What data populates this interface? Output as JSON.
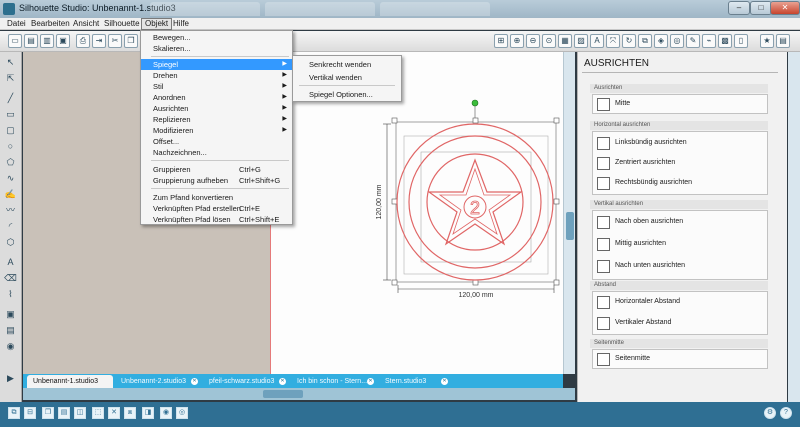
{
  "window": {
    "title": "Silhouette Studio: Unbenannt-1.studio3",
    "controls": {
      "minimize": "–",
      "maximize": "□",
      "close": "✕"
    }
  },
  "menubar": [
    "Datei",
    "Bearbeiten",
    "Ansicht",
    "Silhouette",
    "Objekt",
    "Hilfe"
  ],
  "object_menu": {
    "items": [
      {
        "label": "Bewegen...",
        "shortcut": "",
        "submenu": false
      },
      {
        "label": "Skalieren...",
        "shortcut": "",
        "submenu": false
      },
      {
        "label": "Spiegel",
        "shortcut": "",
        "submenu": true,
        "highlighted": true
      },
      {
        "label": "Drehen",
        "shortcut": "",
        "submenu": true
      },
      {
        "label": "Stil",
        "shortcut": "",
        "submenu": true
      },
      {
        "label": "Anordnen",
        "shortcut": "",
        "submenu": true
      },
      {
        "label": "Ausrichten",
        "shortcut": "",
        "submenu": true
      },
      {
        "label": "Replizieren",
        "shortcut": "",
        "submenu": true
      },
      {
        "label": "Modifizieren",
        "shortcut": "",
        "submenu": true
      },
      {
        "label": "Offset...",
        "shortcut": "",
        "submenu": false
      },
      {
        "label": "Nachzeichnen...",
        "shortcut": "",
        "submenu": false
      },
      {
        "label": "Gruppieren",
        "shortcut": "Ctrl+G",
        "submenu": false
      },
      {
        "label": "Gruppierung aufheben",
        "shortcut": "Ctrl+Shift+G",
        "submenu": false
      },
      {
        "label": "Zum Pfand konvertieren",
        "shortcut": "",
        "submenu": false
      },
      {
        "label": "Verknüpften Pfad erstellen",
        "shortcut": "Ctrl+E",
        "submenu": false
      },
      {
        "label": "Verknüpften Pfad lösen",
        "shortcut": "Ctrl+Shift+E",
        "submenu": false
      }
    ]
  },
  "mirror_submenu": [
    "Senkrecht wenden",
    "Vertikal wenden",
    "Spiegel Optionen..."
  ],
  "canvas": {
    "height_dim": "120,00 mm",
    "width_dim": "120,00 mm",
    "star_number": "2"
  },
  "panel": {
    "title": "AUSRICHTEN",
    "sections": [
      {
        "title": "Ausrichten",
        "buttons": [
          "Mitte"
        ]
      },
      {
        "title": "Horizontal ausrichten",
        "buttons": [
          "Linksbündig ausrichten",
          "Zentriert ausrichten",
          "Rechtsbündig ausrichten"
        ]
      },
      {
        "title": "Vertikal ausrichten",
        "buttons": [
          "Nach oben ausrichten",
          "Mittig ausrichten",
          "Nach unten ausrichten"
        ]
      },
      {
        "title": "Abstand",
        "buttons": [
          "Horizontaler Abstand",
          "Vertikaler Abstand"
        ]
      },
      {
        "title": "Seitenmitte",
        "buttons": [
          "Seitenmitte"
        ]
      }
    ]
  },
  "doc_tabs": [
    {
      "label": "Unbenannt-1.studio3",
      "active": true
    },
    {
      "label": "Unbenannt-2.studio3",
      "active": false
    },
    {
      "label": "pfeil-schwarz.studio3",
      "active": false
    },
    {
      "label": "Ich bin schon - Stern...",
      "active": false
    },
    {
      "label": "Stern.studio3",
      "active": false
    }
  ],
  "colors": {
    "accent_blue": "#3399ff",
    "design_red": "#e06666",
    "tab_bar": "#32aee0",
    "bottom_bar": "#2f6f93"
  }
}
